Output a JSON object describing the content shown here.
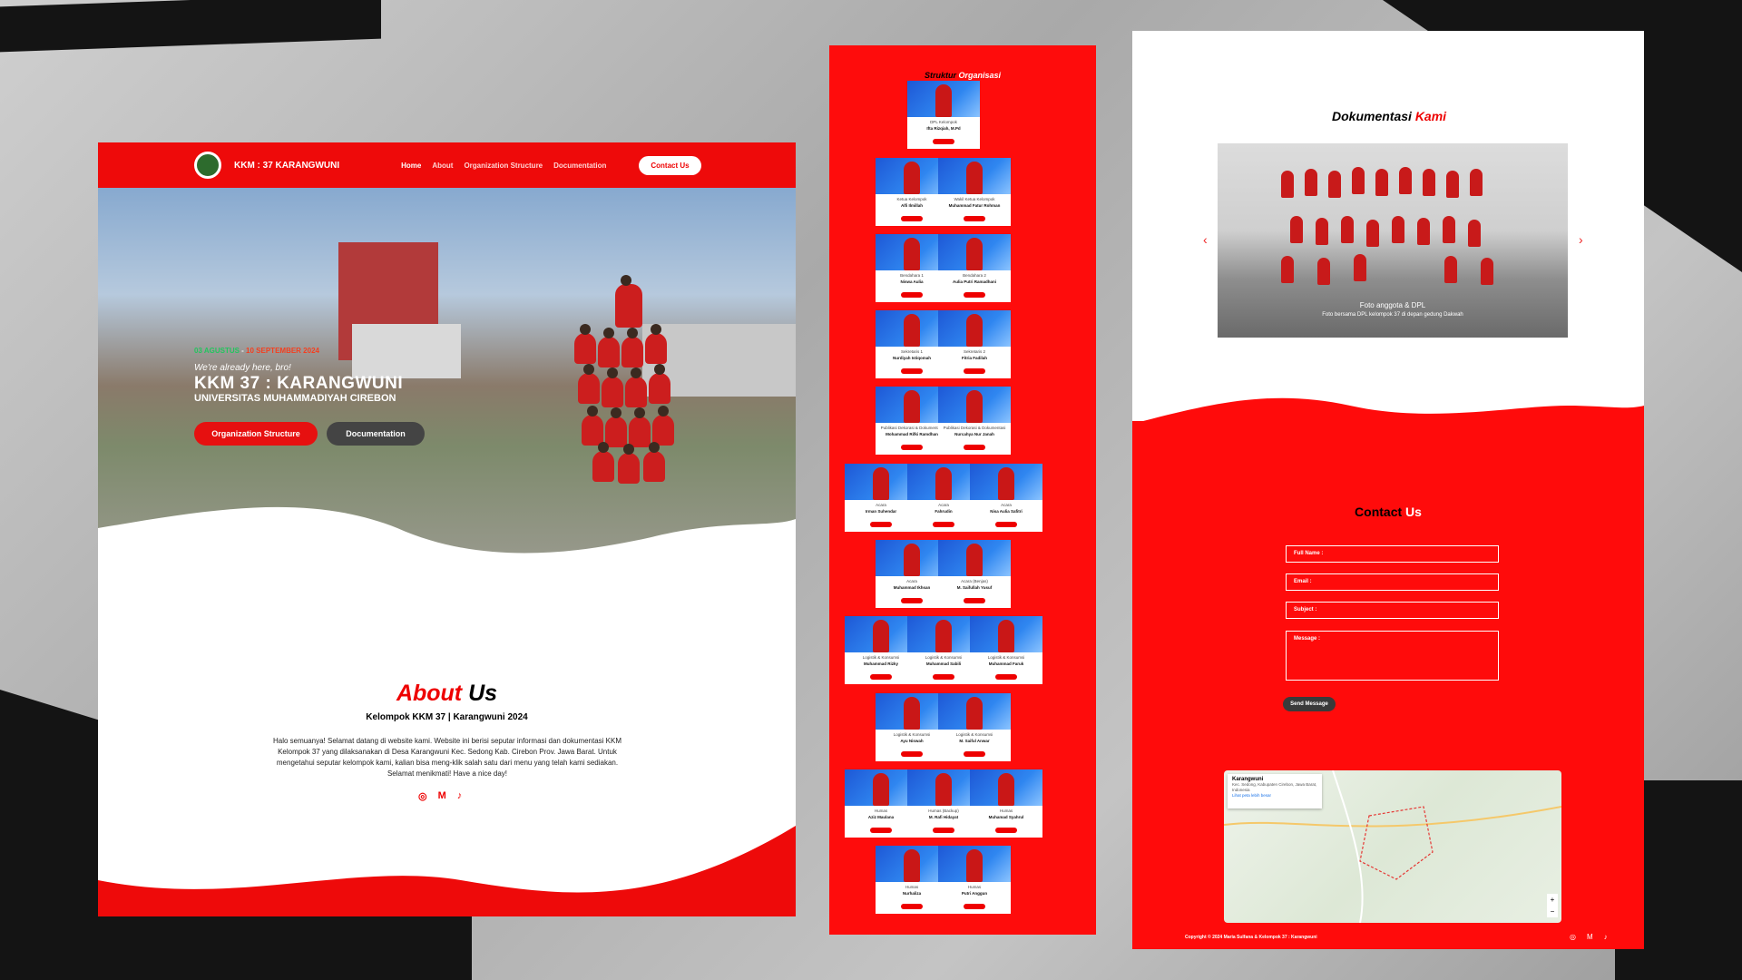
{
  "nav": {
    "brand": "KKM : 37 KARANGWUNI",
    "menu": [
      "Home",
      "About",
      "Organization Structure",
      "Documentation"
    ],
    "contact": "Contact Us"
  },
  "hero": {
    "date_start": "03 AGUSTUS",
    "date_sep": " - ",
    "date_end": "10 SEPTEMBER 2024",
    "subtitle": "We're already here, bro!",
    "title": "KKM 37 : KARANGWUNI",
    "university": "UNIVERSITAS MUHAMMADIYAH CIREBON",
    "btn_org": "Organization Structure",
    "btn_doc": "Documentation"
  },
  "about": {
    "title_a": "About",
    "title_b": "Us",
    "subtitle": "Kelompok KKM 37 | Karangwuni 2024",
    "paragraph": "Halo semuanya! Selamat datang di website kami. Website ini berisi seputar informasi dan dokumentasi KKM Kelompok 37 yang dilaksanakan di Desa Karangwuni Kec. Sedong Kab. Cirebon Prov. Jawa Barat. Untuk mengetahui seputar kelompok kami, kalian bisa meng-klik salah satu dari menu yang telah kami sediakan. Selamat menikmati! Have a nice day!",
    "social": [
      "instagram-icon",
      "mail-icon",
      "tiktok-icon"
    ]
  },
  "structure": {
    "title_a": "Struktur",
    "title_b": "Organisasi",
    "cards": [
      {
        "role": "DPL Kelompok",
        "name": "Ifta Rizqiah, M.Pd"
      },
      {
        "role": "Ketua Kelompok",
        "name": "Alfi Ilmillah"
      },
      {
        "role": "Wakil Ketua Kelompok",
        "name": "Muhammad Fatur Rohman"
      },
      {
        "role": "Bendahara 1",
        "name": "Niswa Aulia"
      },
      {
        "role": "Bendahara 2",
        "name": "Aulia Putri Ramadhani"
      },
      {
        "role": "Sekretaris 1",
        "name": "Nurdiyah Istiqomah"
      },
      {
        "role": "Sekretaris 2",
        "name": "Fitria Fadilah"
      },
      {
        "role": "Publikasi Dekorasi & Dokumentasi",
        "name": "Mohammad Rifki Ramdhan"
      },
      {
        "role": "Publikasi Dekorasi & Dokumentasi",
        "name": "Nurcahya Nur Janah"
      },
      {
        "role": "Acara",
        "name": "Irman Suhendar"
      },
      {
        "role": "Acara",
        "name": "Fahrudin"
      },
      {
        "role": "Acara",
        "name": "Nisa Aulia Safitri"
      },
      {
        "role": "Acara",
        "name": "Muhammad Ikhsan"
      },
      {
        "role": "Acara (Benjas)",
        "name": "M. Saifullah Yusuf"
      },
      {
        "role": "Logistik & Konsumsi",
        "name": "Muhammad Rizky"
      },
      {
        "role": "Logistik & Konsumsi",
        "name": "Muhammad Sabili"
      },
      {
        "role": "Logistik & Konsumsi",
        "name": "Muhammad Faruk"
      },
      {
        "role": "Logistik & Konsumsi",
        "name": "Ayu Niswah"
      },
      {
        "role": "Logistik & Konsumsi",
        "name": "M. Saiful Anwar"
      },
      {
        "role": "Humas",
        "name": "Aziz Maulana"
      },
      {
        "role": "Humas (Backup)",
        "name": "M. Rafi Hidayat"
      },
      {
        "role": "Humas",
        "name": "Muhamad Syahrul"
      },
      {
        "role": "Humas",
        "name": "Nurhaliza"
      },
      {
        "role": "Humas",
        "name": "Putri Anggun"
      }
    ]
  },
  "docs": {
    "title_a": "Dokumentasi",
    "title_b": "Kami",
    "caption1": "Foto anggota & DPL",
    "caption2": "Foto bersama DPL kelompok 37 di depan gedung Dakwah",
    "prev": "‹",
    "next": "›"
  },
  "contact": {
    "title_a": "Contact",
    "title_b": "Us",
    "full_name": "Full Name :",
    "email": "Email :",
    "subject": "Subject :",
    "message": "Message :",
    "send": "Send Message"
  },
  "map": {
    "place": "Karangwuni",
    "address": "Kec. Sedong, Kabupaten Cirebon, Jawa Barat, Indonesia",
    "link": "Lihat peta lebih besar",
    "zoom_in": "+",
    "zoom_out": "−"
  },
  "footer": {
    "copyright": "Copyright © 2024 Maria Sulfana & Kelompok 37 : Karangwuni",
    "social": [
      "instagram-icon",
      "mail-icon",
      "tiktok-icon"
    ]
  }
}
